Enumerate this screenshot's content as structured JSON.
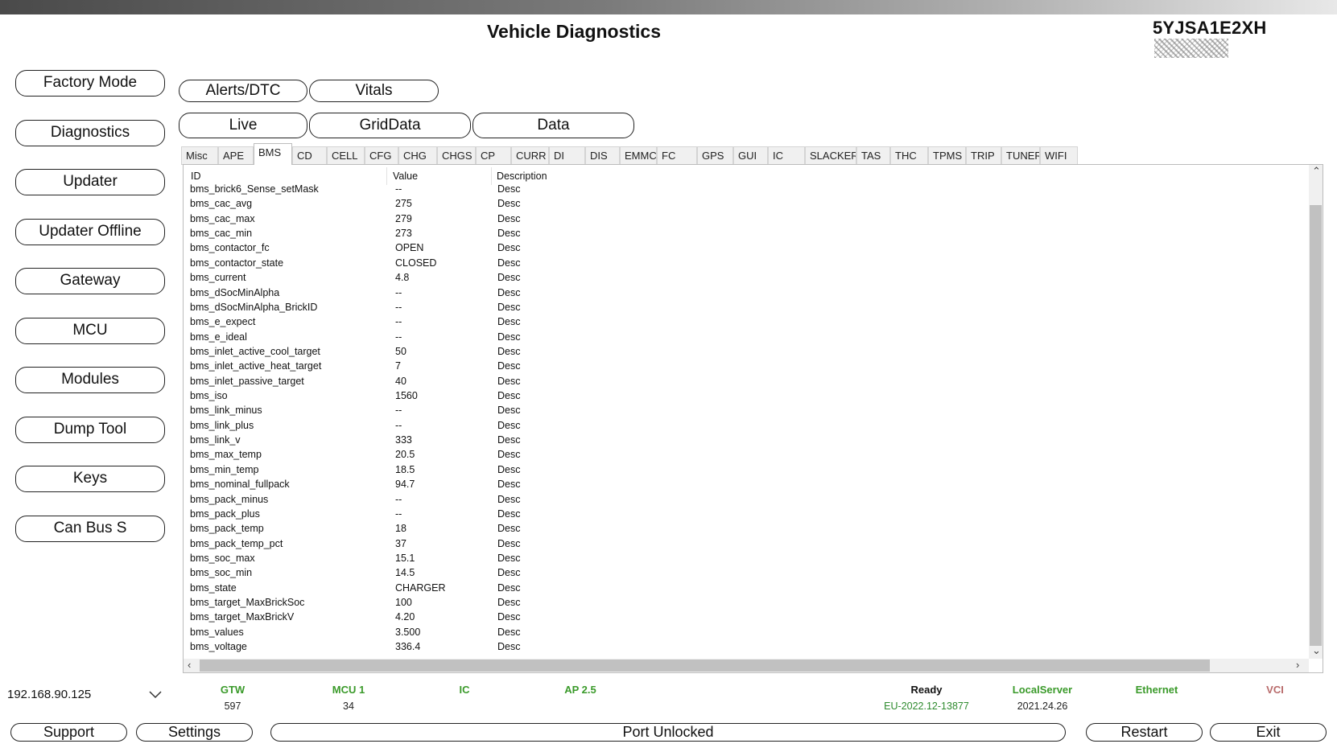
{
  "header": {
    "title": "Vehicle Diagnostics",
    "vin": "5YJSA1E2XH"
  },
  "sidebar": {
    "buttons": [
      "Factory Mode",
      "Diagnostics",
      "Updater",
      "Updater Offline",
      "Gateway",
      "MCU",
      "Modules",
      "Dump Tool",
      "Keys",
      "Can Bus S"
    ]
  },
  "view_tabs": {
    "row1": [
      "Alerts/DTC",
      "Vitals"
    ],
    "row2": [
      "Live",
      "GridData",
      "Data"
    ]
  },
  "category_tabs": {
    "items": [
      "Misc",
      "APE",
      "BMS",
      "CD",
      "CELL",
      "CFG",
      "CHG",
      "CHGS",
      "CP",
      "CURR",
      "DI",
      "DIS",
      "EMMC",
      "FC",
      "GPS",
      "GUI",
      "IC",
      "SLACKER",
      "TAS",
      "THC",
      "TPMS",
      "TRIP",
      "TUNER",
      "WIFI"
    ],
    "active": "BMS"
  },
  "grid": {
    "headers": [
      "ID",
      "Value",
      "Description"
    ],
    "rows": [
      [
        "bms_brick6_Sense_setMask",
        "--",
        "Desc"
      ],
      [
        "bms_cac_avg",
        "275",
        "Desc"
      ],
      [
        "bms_cac_max",
        "279",
        "Desc"
      ],
      [
        "bms_cac_min",
        "273",
        "Desc"
      ],
      [
        "bms_contactor_fc",
        "OPEN",
        "Desc"
      ],
      [
        "bms_contactor_state",
        "CLOSED",
        "Desc"
      ],
      [
        "bms_current",
        "4.8",
        "Desc"
      ],
      [
        "bms_dSocMinAlpha",
        "--",
        "Desc"
      ],
      [
        "bms_dSocMinAlpha_BrickID",
        "--",
        "Desc"
      ],
      [
        "bms_e_expect",
        "--",
        "Desc"
      ],
      [
        "bms_e_ideal",
        "--",
        "Desc"
      ],
      [
        "bms_inlet_active_cool_target",
        "50",
        "Desc"
      ],
      [
        "bms_inlet_active_heat_target",
        "7",
        "Desc"
      ],
      [
        "bms_inlet_passive_target",
        "40",
        "Desc"
      ],
      [
        "bms_iso",
        "1560",
        "Desc"
      ],
      [
        "bms_link_minus",
        "--",
        "Desc"
      ],
      [
        "bms_link_plus",
        "--",
        "Desc"
      ],
      [
        "bms_link_v",
        "333",
        "Desc"
      ],
      [
        "bms_max_temp",
        "20.5",
        "Desc"
      ],
      [
        "bms_min_temp",
        "18.5",
        "Desc"
      ],
      [
        "bms_nominal_fullpack",
        "94.7",
        "Desc"
      ],
      [
        "bms_pack_minus",
        "--",
        "Desc"
      ],
      [
        "bms_pack_plus",
        "--",
        "Desc"
      ],
      [
        "bms_pack_temp",
        "18",
        "Desc"
      ],
      [
        "bms_pack_temp_pct",
        "37",
        "Desc"
      ],
      [
        "bms_soc_max",
        "15.1",
        "Desc"
      ],
      [
        "bms_soc_min",
        "14.5",
        "Desc"
      ],
      [
        "bms_state",
        "CHARGER",
        "Desc"
      ],
      [
        "bms_target_MaxBrickSoc",
        "100",
        "Desc"
      ],
      [
        "bms_target_MaxBrickV",
        "4.20",
        "Desc"
      ],
      [
        "bms_values",
        "3.500",
        "Desc"
      ],
      [
        "bms_voltage",
        "336.4",
        "Desc"
      ]
    ]
  },
  "connection": {
    "ip": "192.168.90.125"
  },
  "status": [
    {
      "label": "GTW",
      "value": "597",
      "color": "#3a9a2a"
    },
    {
      "label": "MCU 1",
      "value": "34",
      "color": "#3a9a2a"
    },
    {
      "label": "IC",
      "value": "",
      "color": "#3a9a2a"
    },
    {
      "label": "AP 2.5",
      "value": "",
      "color": "#3a9a2a"
    },
    {
      "label": "Ready",
      "value": "EU-2022.12-13877",
      "color": "#111111",
      "value_color": "#2e8b2e"
    },
    {
      "label": "LocalServer",
      "value": "2021.24.26",
      "color": "#3a9a2a"
    },
    {
      "label": "Ethernet",
      "value": "",
      "color": "#3a9a2a"
    },
    {
      "label": "VCI",
      "value": "",
      "color": "#b86a6a"
    }
  ],
  "footer": {
    "support": "Support",
    "settings": "Settings",
    "port_status": "Port Unlocked",
    "restart": "Restart",
    "exit": "Exit"
  }
}
